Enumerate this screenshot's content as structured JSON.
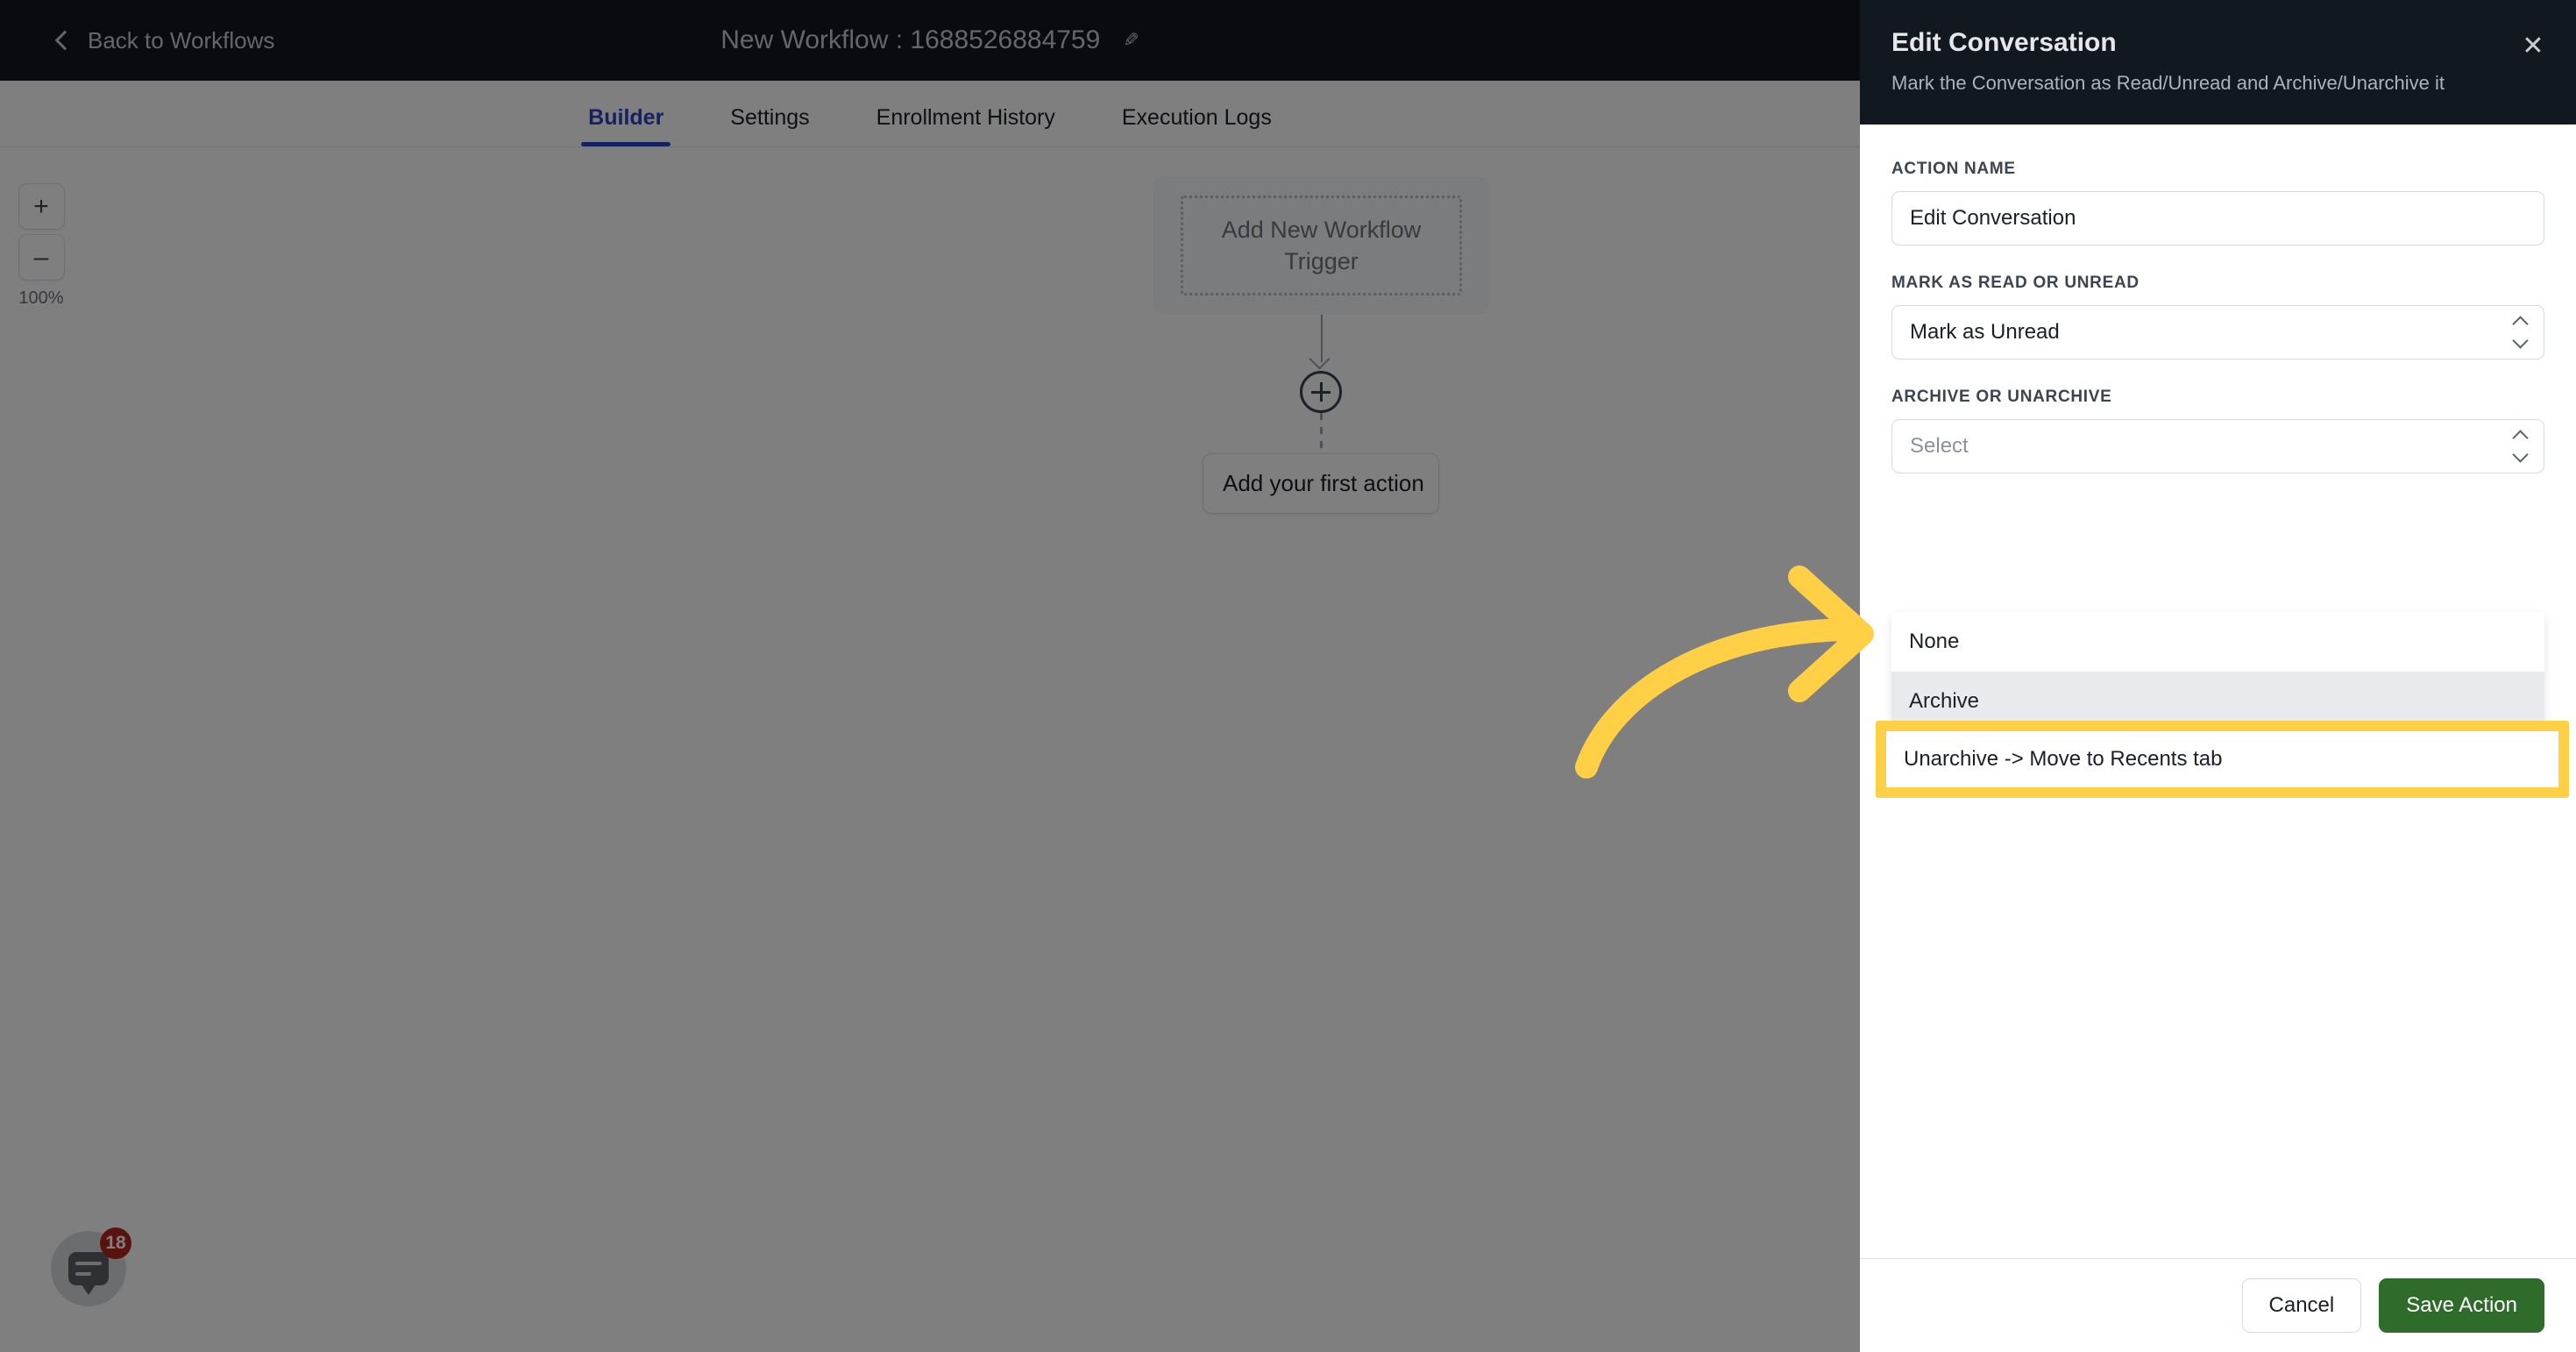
{
  "topbar": {
    "back_label": "Back to Workflows",
    "back_icon": "chevron-left-icon",
    "workflow_title": "New Workflow : 1688526884759",
    "edit_icon": "pencil-icon"
  },
  "tabs": [
    {
      "label": "Builder",
      "active": true
    },
    {
      "label": "Settings",
      "active": false
    },
    {
      "label": "Enrollment History",
      "active": false
    },
    {
      "label": "Execution Logs",
      "active": false
    }
  ],
  "canvas": {
    "zoom_in_label": "+",
    "zoom_out_label": "–",
    "zoom_level": "100%",
    "trigger_placeholder": "Add New Workflow Trigger",
    "add_node_icon": "plus-circle-icon",
    "first_action_label": "Add your first action",
    "chat_icon": "chat-bubble-icon",
    "chat_badge": "18"
  },
  "panel": {
    "title": "Edit Conversation",
    "subtitle": "Mark the Conversation as Read/Unread and Archive/Unarchive it",
    "close_icon": "close-icon",
    "fields": {
      "action_name": {
        "label": "ACTION NAME",
        "value": "Edit Conversation",
        "placeholder": "Action Name"
      },
      "mark_read_unread": {
        "label": "MARK AS READ OR UNREAD",
        "value": "Mark as Unread",
        "stepper_icon": "stepper-updown-icon"
      },
      "archive_unarchive": {
        "label": "ARCHIVE OR UNARCHIVE",
        "value": "Select",
        "stepper_icon": "stepper-updown-icon",
        "options": [
          {
            "label": "None",
            "hovered": false,
            "highlighted": false
          },
          {
            "label": "Archive",
            "hovered": true,
            "highlighted": false
          },
          {
            "label": "Unarchive -> Move to Recents tab",
            "hovered": false,
            "highlighted": true
          }
        ]
      }
    },
    "footer": {
      "cancel_label": "Cancel",
      "save_label": "Save Action"
    }
  },
  "annotation": {
    "arrow_icon": "curved-arrow-right-icon",
    "color": "#ffcf46"
  },
  "colors": {
    "dark_header": "#111820",
    "accent_blue": "#2a42c4",
    "save_green": "#2f6b2b",
    "highlight_yellow": "#ffcf46",
    "badge_red": "#b3261e",
    "overlay": "rgba(0,0,0,0.5)"
  }
}
